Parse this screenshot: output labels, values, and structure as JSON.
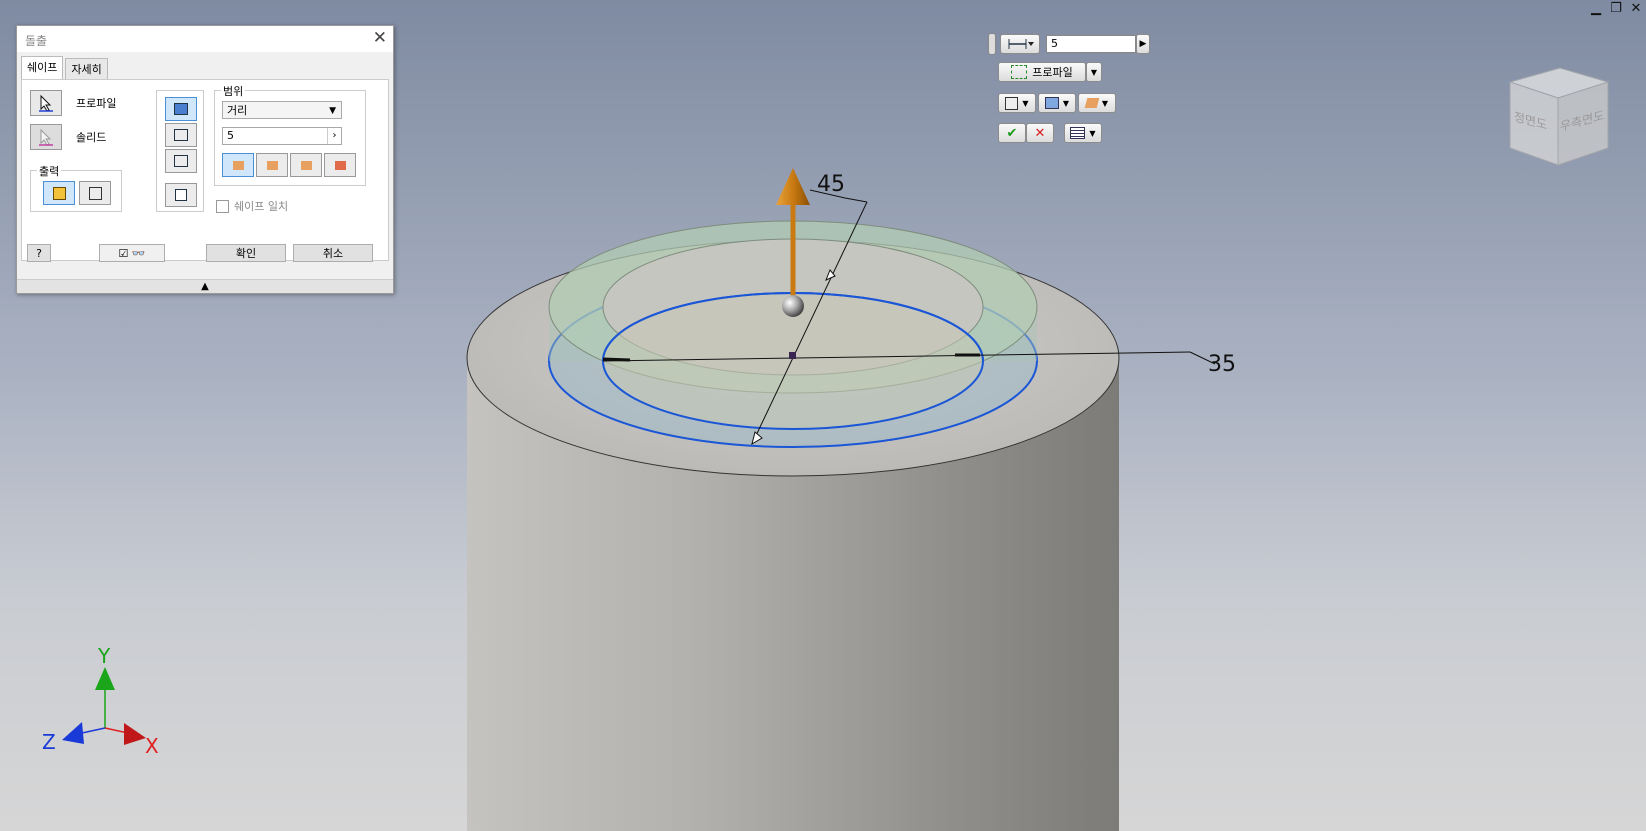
{
  "window_controls": {
    "minimize": "▁",
    "restore": "❐",
    "close": "✕"
  },
  "dialog": {
    "title": "돌출",
    "close_glyph": "✕",
    "tabs": [
      {
        "label": "쉐이프"
      },
      {
        "label": "자세히"
      }
    ],
    "profile_label": "프로파일",
    "solid_label": "솔리드",
    "output_label": "출력",
    "extents_label": "범위",
    "extents_type": "거리",
    "distance_value": "5",
    "match_shape_label": "쉐이프 일치",
    "ok_label": "확인",
    "cancel_label": "취소",
    "preview_checked": true
  },
  "mini_toolbar": {
    "distance_value": "5",
    "profile_label": "프로파일"
  },
  "viewcube": {
    "front_label": "정면도",
    "right_label": "우측면도"
  },
  "dimensions": {
    "outer": "45",
    "inner": "35"
  },
  "axes": {
    "x": "X",
    "y": "Y",
    "z": "Z"
  },
  "colors": {
    "axis_x": "#e02020",
    "axis_y": "#1aa51a",
    "axis_z": "#1a3ad8",
    "arrow": "#c97a12",
    "profile_edge": "#1a56d6"
  }
}
